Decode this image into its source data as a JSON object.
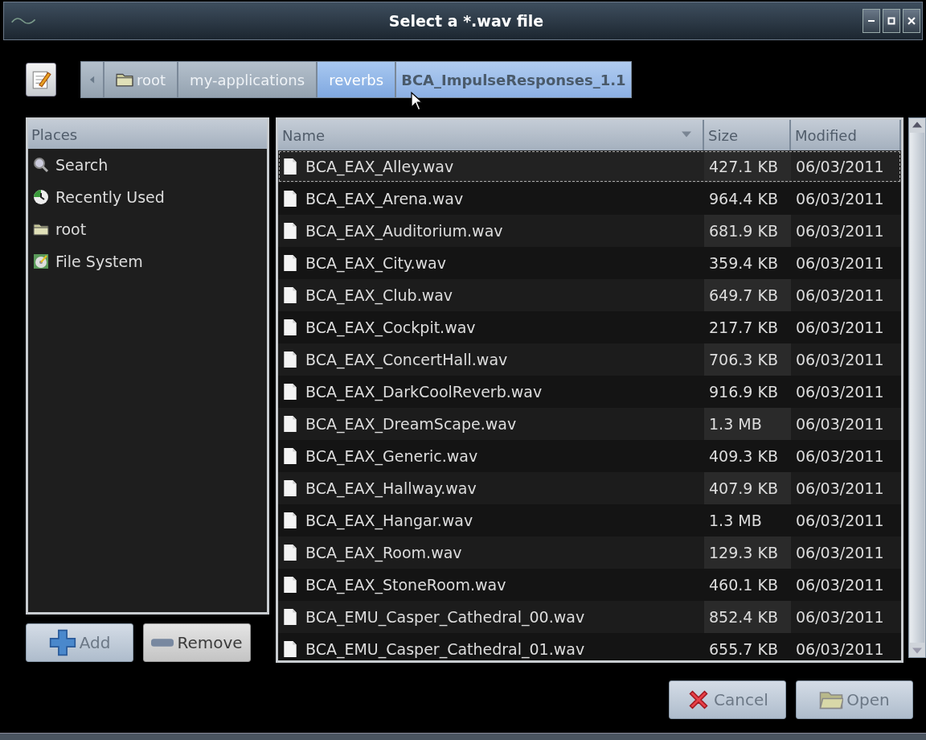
{
  "window": {
    "title": "Select a *.wav file"
  },
  "path_bar": [
    {
      "label": "root",
      "selected": false,
      "hovered": false
    },
    {
      "label": "my-applications",
      "selected": false,
      "hovered": false
    },
    {
      "label": "reverbs",
      "selected": false,
      "hovered": true
    },
    {
      "label": "BCA_ImpulseResponses_1.1",
      "selected": true,
      "hovered": false
    }
  ],
  "places": {
    "header": "Places",
    "items": [
      {
        "label": "Search",
        "kind": "search"
      },
      {
        "label": "Recently Used",
        "kind": "recent"
      },
      {
        "label": "root",
        "kind": "folder"
      },
      {
        "label": "File System",
        "kind": "drive"
      }
    ]
  },
  "place_buttons": [
    {
      "label": "Add",
      "disabled": true
    },
    {
      "label": "Remove",
      "disabled": false
    }
  ],
  "files": {
    "columns": [
      "Name",
      "Size",
      "Modified"
    ],
    "rows": [
      {
        "name": "BCA_EAX_Alley.wav",
        "size": "427.1 KB",
        "modified": "06/03/2011",
        "selected": true
      },
      {
        "name": "BCA_EAX_Arena.wav",
        "size": "964.4 KB",
        "modified": "06/03/2011",
        "selected": false
      },
      {
        "name": "BCA_EAX_Auditorium.wav",
        "size": "681.9 KB",
        "modified": "06/03/2011",
        "selected": false
      },
      {
        "name": "BCA_EAX_City.wav",
        "size": "359.4 KB",
        "modified": "06/03/2011",
        "selected": false
      },
      {
        "name": "BCA_EAX_Club.wav",
        "size": "649.7 KB",
        "modified": "06/03/2011",
        "selected": false
      },
      {
        "name": "BCA_EAX_Cockpit.wav",
        "size": "217.7 KB",
        "modified": "06/03/2011",
        "selected": false
      },
      {
        "name": "BCA_EAX_ConcertHall.wav",
        "size": "706.3 KB",
        "modified": "06/03/2011",
        "selected": false
      },
      {
        "name": "BCA_EAX_DarkCoolReverb.wav",
        "size": "916.9 KB",
        "modified": "06/03/2011",
        "selected": false
      },
      {
        "name": "BCA_EAX_DreamScape.wav",
        "size": "1.3 MB",
        "modified": "06/03/2011",
        "selected": false
      },
      {
        "name": "BCA_EAX_Generic.wav",
        "size": "409.3 KB",
        "modified": "06/03/2011",
        "selected": false
      },
      {
        "name": "BCA_EAX_Hallway.wav",
        "size": "407.9 KB",
        "modified": "06/03/2011",
        "selected": false
      },
      {
        "name": "BCA_EAX_Hangar.wav",
        "size": "1.3 MB",
        "modified": "06/03/2011",
        "selected": false
      },
      {
        "name": "BCA_EAX_Room.wav",
        "size": "129.3 KB",
        "modified": "06/03/2011",
        "selected": false
      },
      {
        "name": "BCA_EAX_StoneRoom.wav",
        "size": "460.1 KB",
        "modified": "06/03/2011",
        "selected": false
      },
      {
        "name": "BCA_EMU_Casper_Cathedral_00.wav",
        "size": "852.4 KB",
        "modified": "06/03/2011",
        "selected": false
      },
      {
        "name": "BCA_EMU_Casper_Cathedral_01.wav",
        "size": "655.7 KB",
        "modified": "06/03/2011",
        "selected": false
      }
    ]
  },
  "dialog_buttons": [
    {
      "label": "Cancel",
      "disabled": true
    },
    {
      "label": "Open",
      "disabled": true
    }
  ]
}
